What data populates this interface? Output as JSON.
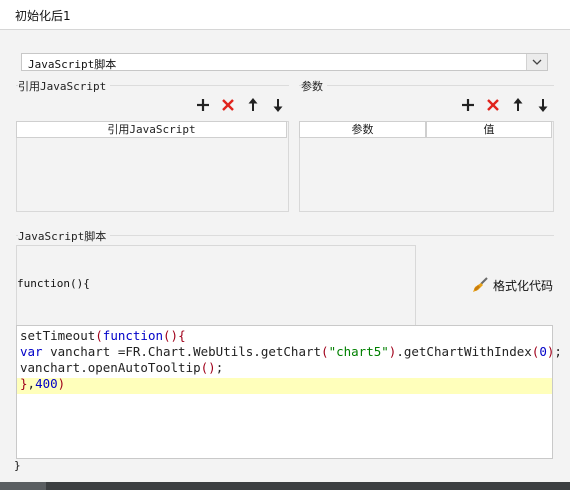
{
  "window": {
    "title": "初始化后1"
  },
  "script_type": {
    "selected": "JavaScript脚本"
  },
  "ref_js": {
    "group_label": "引用JavaScript",
    "column_header": "引用JavaScript",
    "toolbar": [
      "add-icon",
      "delete-icon",
      "arrow-up-icon",
      "arrow-down-icon"
    ]
  },
  "params": {
    "group_label": "参数",
    "column_headers": [
      "参数",
      "值"
    ],
    "toolbar": [
      "add-icon",
      "delete-icon",
      "arrow-up-icon",
      "arrow-down-icon"
    ]
  },
  "script": {
    "group_label": "JavaScript脚本",
    "function_open": "function(){",
    "format_button": "格式化代码",
    "code_lines": [
      "setTimeout(function(){",
      "var vanchart =FR.Chart.WebUtils.getChart(\"chart5\").getChartWithIndex(0);",
      "vanchart.openAutoTooltip();",
      "},400)"
    ],
    "highlighted_line": 4,
    "function_close": "}"
  },
  "colors": {
    "delete_red": "#e0231c",
    "keyword_blue": "#0000c8",
    "string_green": "#008000",
    "highlight_yellow": "#ffffbb"
  }
}
